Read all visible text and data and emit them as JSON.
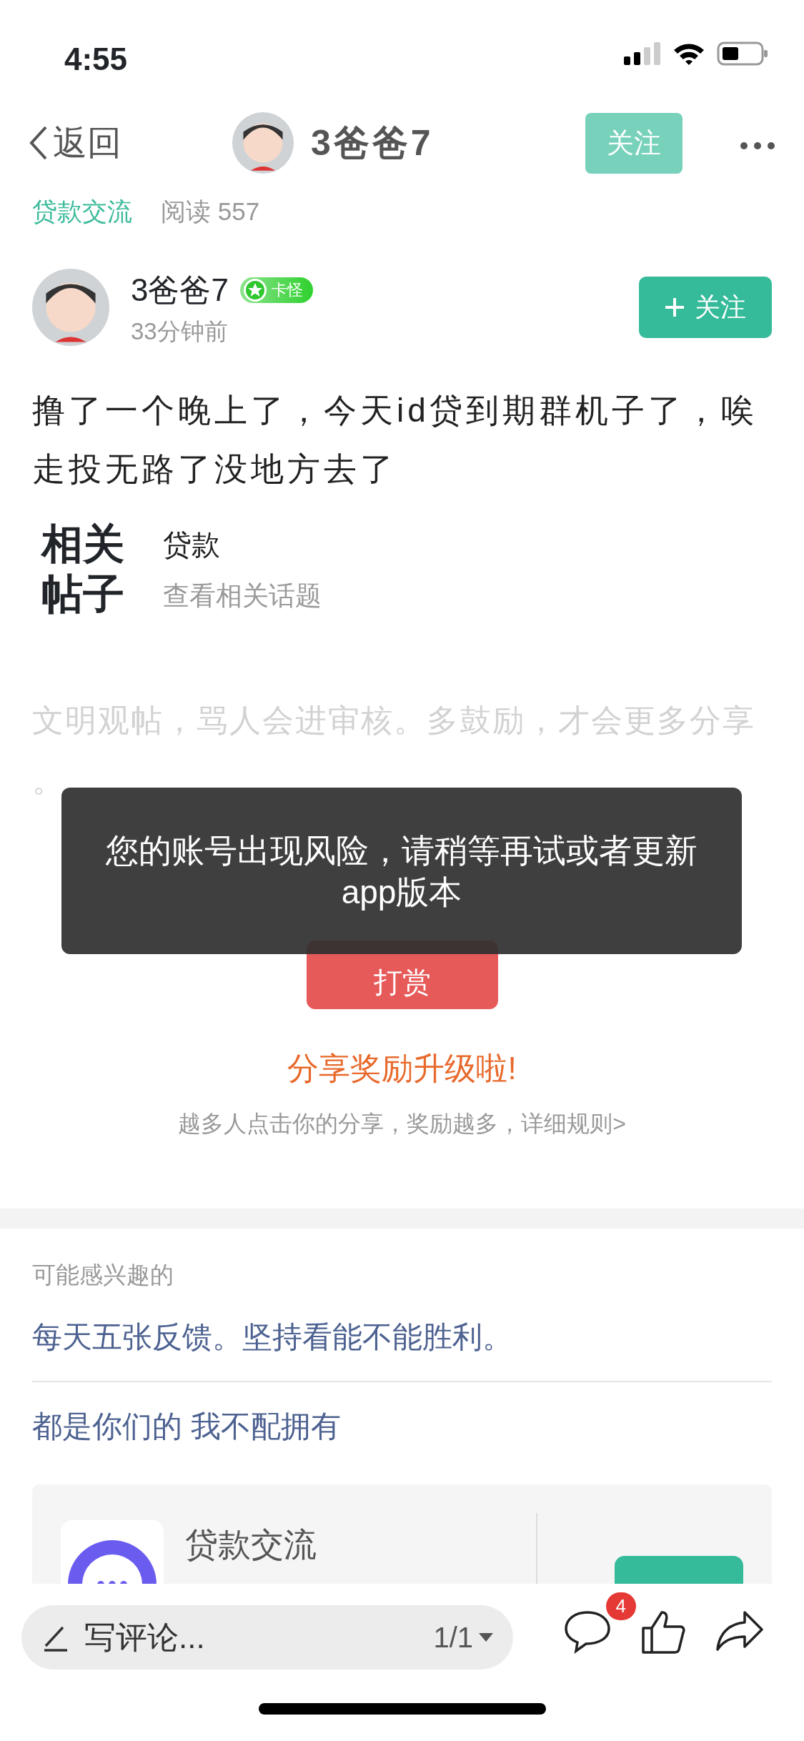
{
  "status_bar": {
    "time": "4:55"
  },
  "nav": {
    "back": "返回",
    "title": "3爸爸7",
    "follow": "关注"
  },
  "meta": {
    "forum": "贷款交流",
    "reads": "阅读 557"
  },
  "author": {
    "name": "3爸爸7",
    "badge": "卡怪",
    "time": "33分钟前",
    "follow": "关注"
  },
  "post": {
    "text": "撸了一个晚上了，今天id贷到期群机子了，唉走投无路了没地方去了"
  },
  "related": {
    "label": "相关帖子",
    "tag": "贷款",
    "link": "查看相关话题"
  },
  "notice": "文明观帖，骂人会进审核。多鼓励，才会更多分享。",
  "tip_button": "打赏",
  "share": {
    "title": "分享奖励升级啦!",
    "subtitle": "越多人点击你的分享，奖励越多，详细规则>"
  },
  "toast": "您的账号出现风险，请稍等再试或者更新app版本",
  "suggestions": {
    "heading": "可能感兴趣的",
    "items": [
      "每天五张反馈。坚持看能不能胜利。",
      "都是你们的 我不配拥有"
    ]
  },
  "forum_card": {
    "name": "贷款交流"
  },
  "bottom_bar": {
    "placeholder": "写评论...",
    "pages": "1/1",
    "comment_count": "4"
  }
}
